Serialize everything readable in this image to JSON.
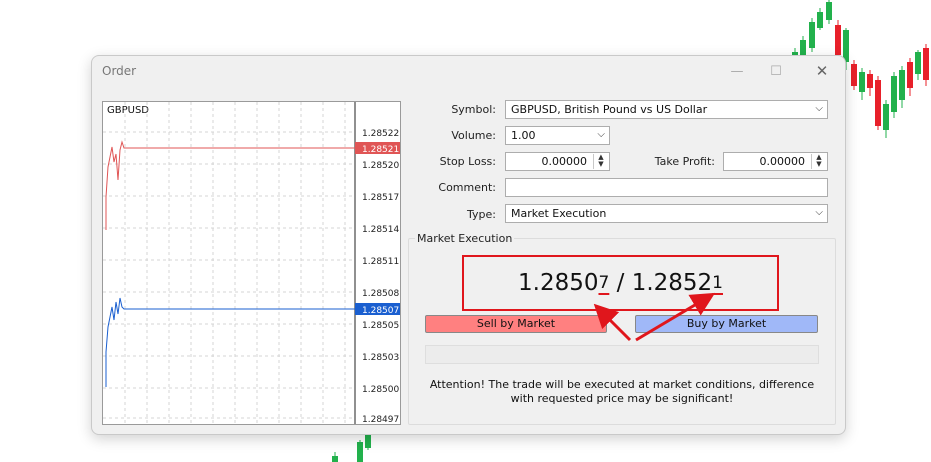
{
  "dialog": {
    "title": "Order",
    "controls": [
      "—",
      "☐",
      "✕"
    ]
  },
  "chart": {
    "symbol": "GBPUSD",
    "ticks": [
      "1.28522",
      "1.28520",
      "1.28517",
      "1.28514",
      "1.28511",
      "1.28508",
      "1.28505",
      "1.28503",
      "1.28500",
      "1.28497"
    ],
    "ask_tag": "1.28521",
    "bid_tag": "1.28507",
    "ask_color": "#e05555",
    "bid_color": "#1a5fd0"
  },
  "form": {
    "symbol_label": "Symbol:",
    "symbol_value": "GBPUSD, British Pound vs US Dollar",
    "volume_label": "Volume:",
    "volume_value": "1.00",
    "stoploss_label": "Stop Loss:",
    "stoploss_value": "0.00000",
    "takeprofit_label": "Take Profit:",
    "takeprofit_value": "0.00000",
    "comment_label": "Comment:",
    "comment_value": "",
    "type_label": "Type:",
    "type_value": "Market Execution"
  },
  "execution": {
    "group_title": "Market Execution",
    "bid_main": "1.2850",
    "bid_last": "7",
    "separator": " / ",
    "ask_main": "1.2852",
    "ask_last": "1",
    "sell_label": "Sell by Market",
    "buy_label": "Buy by Market",
    "sell_color": "#ff8080",
    "buy_color": "#a0b8f8",
    "progress": 0,
    "note": "Attention! The trade will be executed at market conditions, difference with requested price may be significant!",
    "highlight_color": "#e0161c"
  }
}
